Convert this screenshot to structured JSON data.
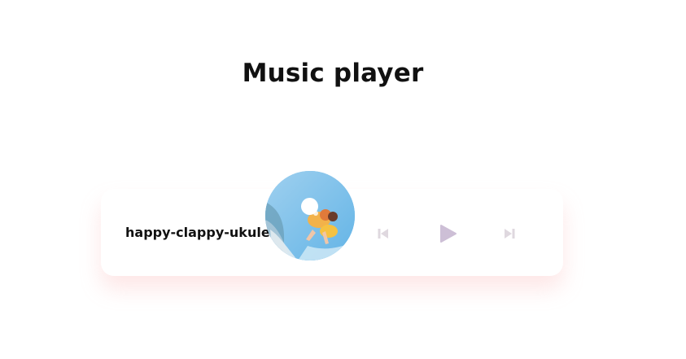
{
  "page": {
    "title": "Music player"
  },
  "player": {
    "track_name": "happy-clappy-ukulele",
    "album_art": "album-cover-girl-at-beach",
    "controls": {
      "prev_icon": "skip-previous-icon",
      "play_icon": "play-icon",
      "next_icon": "skip-next-icon"
    }
  },
  "colors": {
    "text": "#111111",
    "card_background": "#ffffff",
    "card_shadow": "#fca9a9",
    "control_muted": "#dfd8df",
    "play_button": "#cdbfd6"
  }
}
